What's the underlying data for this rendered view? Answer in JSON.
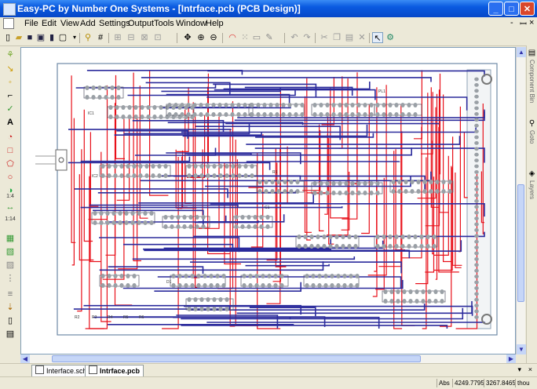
{
  "window": {
    "title": "Easy-PC by Number One Systems - [Intrface.pcb (PCB Design)]",
    "controls": {
      "minimize": "_",
      "maximize": "□",
      "close": "✕"
    }
  },
  "menubar": {
    "items": [
      "File",
      "Edit",
      "View",
      "Add",
      "Settings",
      "Output",
      "Tools",
      "Window",
      "Help"
    ],
    "mdi_controls": {
      "minimize": "-",
      "restore": "ꟷ",
      "close": "×"
    }
  },
  "toolbar": {
    "buttons": [
      "new-doc-icon",
      "open-folder-icon",
      "save-icon",
      "save-all-icon",
      "library-icon",
      "panels-icon",
      "dropdown-icon",
      "wizard-icon",
      "grid-icon",
      "align-icon",
      "distribute-icon",
      "spread-icon",
      "nudge-icon",
      "pan-icon",
      "zoom-in-icon",
      "zoom-out-icon",
      "rainbow-icon",
      "dot-grid-icon",
      "toggle-icon",
      "pencil-icon",
      "undo-icon",
      "redo-icon",
      "cut-icon",
      "copy-icon",
      "paste-icon",
      "delete-icon",
      "select-icon",
      "properties-icon"
    ]
  },
  "left_toolbar": {
    "icon_names": [
      "add-component-icon",
      "add-track-icon",
      "add-pad-icon",
      "add-connection-icon",
      "add-via-icon",
      "add-text-icon",
      "add-shape-icon",
      "add-rect-icon",
      "add-polygon-icon",
      "add-circle-icon",
      "add-arc-icon",
      "measure-icon",
      "spacing-icon",
      "dimension-icon",
      "copper-pour-icon",
      "area-icon",
      "hatching-icon",
      "drill-icon",
      "design-rules-icon",
      "layer-icon",
      "doc-icon",
      "print-icon"
    ],
    "tags": {
      "measure": "1:4",
      "dimension": "1:14"
    }
  },
  "right_panel": {
    "tabs": [
      {
        "icon": "component-bin-icon",
        "label": "Component Bin"
      },
      {
        "icon": "goto-icon",
        "label": "Goto"
      },
      {
        "icon": "layers-icon",
        "label": "Layers"
      }
    ]
  },
  "document_tabs": [
    {
      "label": "Interface.sch",
      "active": false
    },
    {
      "label": "Intrface.pcb",
      "active": true
    }
  ],
  "tabbar": {
    "pin": "▾",
    "close": "×"
  },
  "status": {
    "mode": "Abs",
    "x": "4249.7795",
    "y": "3267.8465",
    "units": "thou"
  },
  "pcb": {
    "silkscreen_labels": [
      "PL1",
      "IC1",
      "IC2",
      "C1",
      "R1",
      "R2",
      "R3",
      "R4",
      "R5",
      "R6",
      "D1"
    ],
    "track_colors": {
      "top": "#e8101a",
      "bottom": "#2b2b9c",
      "board": "#6e8aa6",
      "pad": "#9aa0a6"
    }
  }
}
